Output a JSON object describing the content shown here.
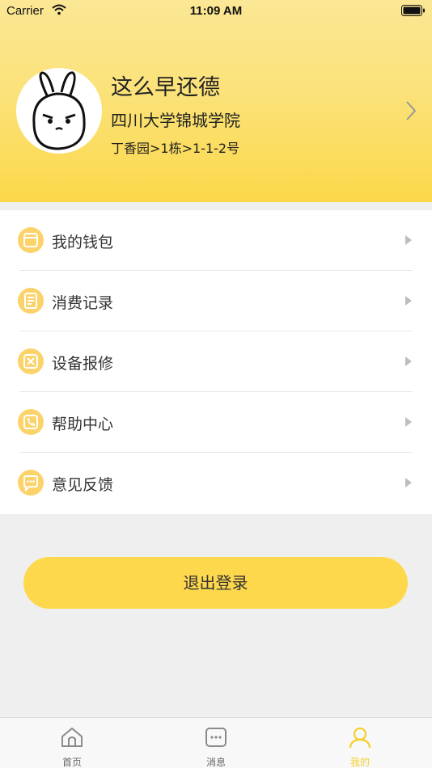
{
  "status_bar": {
    "carrier": "Carrier",
    "time": "11:09 AM"
  },
  "profile": {
    "name": "这么早还德",
    "school": "四川大学锦城学院",
    "address": "丁香园>1栋>1-1-2号"
  },
  "menu": {
    "items": [
      {
        "label": "我的钱包",
        "icon": "wallet-icon"
      },
      {
        "label": "消费记录",
        "icon": "records-icon"
      },
      {
        "label": "设备报修",
        "icon": "repair-icon"
      },
      {
        "label": "帮助中心",
        "icon": "phone-icon"
      },
      {
        "label": "意见反馈",
        "icon": "feedback-icon"
      }
    ]
  },
  "logout_label": "退出登录",
  "tabs": [
    {
      "label": "首页",
      "icon": "home-icon"
    },
    {
      "label": "消息",
      "icon": "message-icon"
    },
    {
      "label": "我的",
      "icon": "person-icon",
      "active": true
    }
  ],
  "colors": {
    "accent": "#fed84c",
    "active_tab": "#f5cf2e",
    "icon_circle": "#fbd36a"
  }
}
